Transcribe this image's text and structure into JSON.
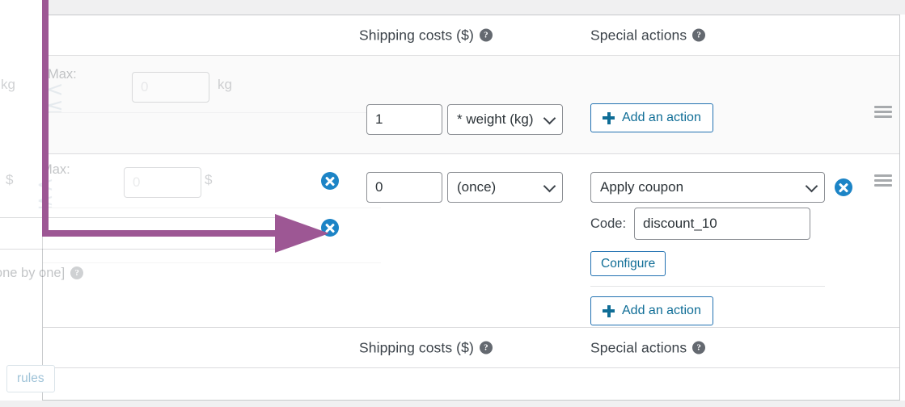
{
  "table": {
    "header": {
      "shipping_costs": "Shipping costs ($)",
      "special_actions": "Special actions",
      "help_glyph": "?"
    },
    "header_bottom": {
      "shipping_costs": "Shipping costs ($)",
      "special_actions": "Special actions",
      "help_glyph": "?"
    }
  },
  "row1": {
    "max_label": "Max:",
    "comparators": "< ≤",
    "max_value": "",
    "max_placeholder": "0",
    "unit": "kg",
    "cost_value": "1",
    "multiplier": "* weight (kg)",
    "add_action_label": "Add an action",
    "drag_handle": "drag-handle-icon"
  },
  "row2": {
    "max_label": "Max:",
    "comparators": "< ≤",
    "max_value": "",
    "max_placeholder": "0",
    "unit": "$",
    "cost_value": "0",
    "multiplier": "(once)",
    "action_selected": "Apply coupon",
    "code_label": "Code:",
    "code_value": "discount_10",
    "configure_label": "Configure",
    "add_action_label": "Add an action",
    "tail_text": "ed one by one]",
    "drag_handle": "drag-handle-icon",
    "delete_icon": "close-circle-icon"
  },
  "footer": {
    "rules_button": "rules"
  },
  "annotation": {
    "color": "#9d5794",
    "shape": "arrow-pointing-right"
  },
  "colors": {
    "accent_blue": "#2271b1",
    "link_blue": "#0f6d96",
    "delete_blue": "#1c84c6",
    "annotation_purple": "#9d5794",
    "row_alt_bg": "#fafafa",
    "border_gray": "#dcdcde"
  }
}
